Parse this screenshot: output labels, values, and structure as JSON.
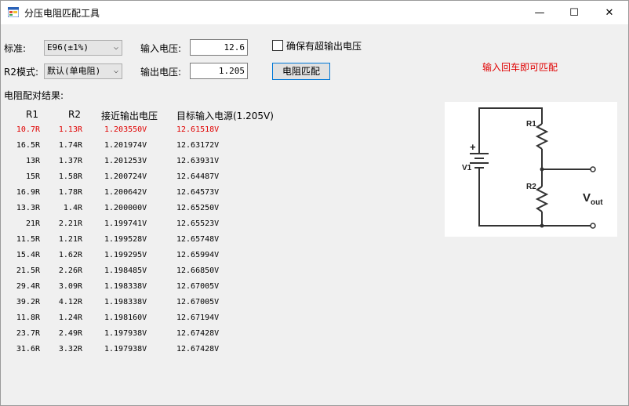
{
  "window": {
    "title": "分压电阻匹配工具",
    "minimize": "—",
    "maximize": "☐",
    "close": "✕"
  },
  "form": {
    "standard_label": "标准:",
    "standard_value": "E96(±1%)",
    "r2mode_label": "R2模式:",
    "r2mode_value": "默认(单电阻)",
    "vin_label": "输入电压:",
    "vin_value": "12.6",
    "vout_label": "输出电压:",
    "vout_value": "1.205",
    "check_label": "确保有超输出电压",
    "match_button": "电阻匹配",
    "hint": "输入回车即可匹配"
  },
  "results": {
    "title": "电阻配对结果:",
    "headers": [
      "R1",
      "R2",
      "接近输出电压",
      "目标输入电源(1.205V)"
    ],
    "rows": [
      [
        "10.7R",
        "1.13R",
        "1.203550V",
        "12.61518V"
      ],
      [
        "16.5R",
        "1.74R",
        "1.201974V",
        "12.63172V"
      ],
      [
        "13R",
        "1.37R",
        "1.201253V",
        "12.63931V"
      ],
      [
        "15R",
        "1.58R",
        "1.200724V",
        "12.64487V"
      ],
      [
        "16.9R",
        "1.78R",
        "1.200642V",
        "12.64573V"
      ],
      [
        "13.3R",
        "1.4R",
        "1.200000V",
        "12.65250V"
      ],
      [
        "21R",
        "2.21R",
        "1.199741V",
        "12.65523V"
      ],
      [
        "11.5R",
        "1.21R",
        "1.199528V",
        "12.65748V"
      ],
      [
        "15.4R",
        "1.62R",
        "1.199295V",
        "12.65994V"
      ],
      [
        "21.5R",
        "2.26R",
        "1.198485V",
        "12.66850V"
      ],
      [
        "29.4R",
        "3.09R",
        "1.198338V",
        "12.67005V"
      ],
      [
        "39.2R",
        "4.12R",
        "1.198338V",
        "12.67005V"
      ],
      [
        "11.8R",
        "1.24R",
        "1.198160V",
        "12.67194V"
      ],
      [
        "23.7R",
        "2.49R",
        "1.197938V",
        "12.67428V"
      ],
      [
        "31.6R",
        "3.32R",
        "1.197938V",
        "12.67428V"
      ]
    ]
  },
  "diagram": {
    "r1": "R1",
    "r2": "R2",
    "v1": "V1",
    "plus": "+",
    "vout_main": "V",
    "vout_sub": "out"
  },
  "colors": {
    "highlight": "#e00000",
    "accent": "#0078d7"
  }
}
